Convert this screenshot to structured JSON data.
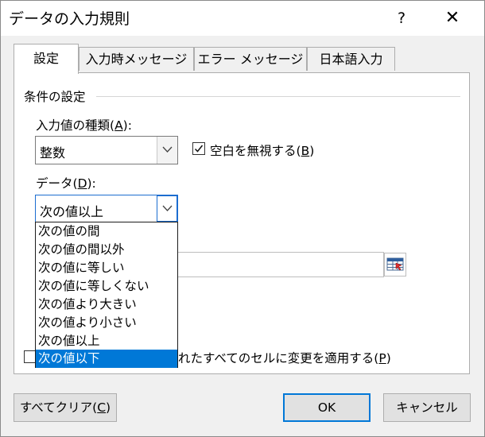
{
  "window": {
    "title": "データの入力規則",
    "help": "?",
    "close": "✕"
  },
  "tabs": [
    {
      "label": "設定",
      "active": true
    },
    {
      "label": "入力時メッセージ",
      "active": false
    },
    {
      "label": "エラー メッセージ",
      "active": false
    },
    {
      "label": "日本語入力",
      "active": false
    }
  ],
  "settings": {
    "section_title": "条件の設定",
    "allow_label_pre": "入力値の種類(",
    "allow_label_key": "A",
    "allow_label_post": "):",
    "allow_value": "整数",
    "ignore_blank_pre": "空白を無視する(",
    "ignore_blank_key": "B",
    "ignore_blank_post": ")",
    "ignore_blank_checked": true,
    "data_label_pre": "データ(",
    "data_label_key": "D",
    "data_label_post": "):",
    "data_value": "次の値以上",
    "data_options": [
      {
        "label": "次の値の間",
        "selected": false
      },
      {
        "label": "次の値の間以外",
        "selected": false
      },
      {
        "label": "次の値に等しい",
        "selected": false
      },
      {
        "label": "次の値に等しくない",
        "selected": false
      },
      {
        "label": "次の値より大きい",
        "selected": false
      },
      {
        "label": "次の値より小さい",
        "selected": false
      },
      {
        "label": "次の値以上",
        "selected": false
      },
      {
        "label": "次の値以下",
        "selected": true
      }
    ],
    "apply_all_visible_pre": "れたすべてのセルに変更を適用する(",
    "apply_all_key": "P",
    "apply_all_post": ")"
  },
  "buttons": {
    "clear_pre": "すべてクリア(",
    "clear_key": "C",
    "clear_post": ")",
    "ok": "OK",
    "cancel": "キャンセル"
  }
}
